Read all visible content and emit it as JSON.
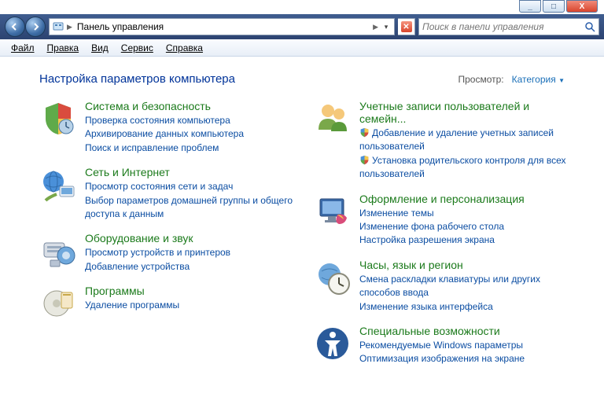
{
  "window": {
    "minimize": "_",
    "maximize": "□",
    "close": "X"
  },
  "nav": {
    "address_text": "Панель управления",
    "search_placeholder": "Поиск в панели управления"
  },
  "menu": {
    "file": "Файл",
    "edit": "Правка",
    "view": "Вид",
    "tools": "Сервис",
    "help": "Справка"
  },
  "heading": "Настройка параметров компьютера",
  "viewby": {
    "label": "Просмотр:",
    "value": "Категория"
  },
  "left": [
    {
      "title": "Система и безопасность",
      "links": [
        {
          "t": "Проверка состояния компьютера"
        },
        {
          "t": "Архивирование данных компьютера"
        },
        {
          "t": "Поиск и исправление проблем"
        }
      ]
    },
    {
      "title": "Сеть и Интернет",
      "links": [
        {
          "t": "Просмотр состояния сети и задач"
        },
        {
          "t": "Выбор параметров домашней группы и общего доступа к данным"
        }
      ]
    },
    {
      "title": "Оборудование и звук",
      "links": [
        {
          "t": "Просмотр устройств и принтеров"
        },
        {
          "t": "Добавление устройства"
        }
      ]
    },
    {
      "title": "Программы",
      "links": [
        {
          "t": "Удаление программы"
        }
      ]
    }
  ],
  "right": [
    {
      "title": "Учетные записи пользователей и семейн...",
      "links": [
        {
          "t": "Добавление и удаление учетных записей пользователей",
          "shield": true
        },
        {
          "t": "Установка родительского контроля для всех пользователей",
          "shield": true
        }
      ]
    },
    {
      "title": "Оформление и персонализация",
      "links": [
        {
          "t": "Изменение темы"
        },
        {
          "t": "Изменение фона рабочего стола"
        },
        {
          "t": "Настройка разрешения экрана"
        }
      ]
    },
    {
      "title": "Часы, язык и регион",
      "links": [
        {
          "t": "Смена раскладки клавиатуры или других способов ввода"
        },
        {
          "t": "Изменение языка интерфейса"
        }
      ]
    },
    {
      "title": "Специальные возможности",
      "links": [
        {
          "t": "Рекомендуемые Windows параметры"
        },
        {
          "t": "Оптимизация изображения на экране"
        }
      ]
    }
  ]
}
